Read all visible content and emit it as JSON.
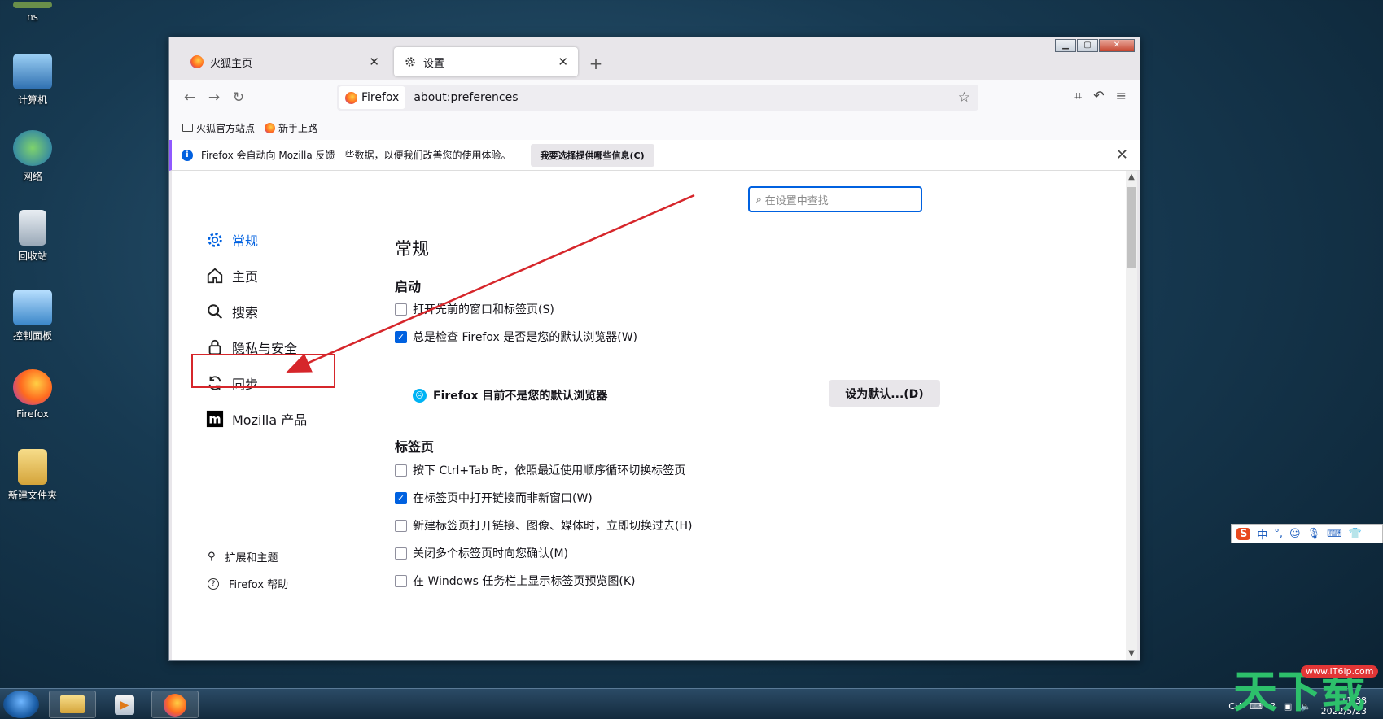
{
  "desktop": {
    "icons": [
      {
        "label": "ns"
      },
      {
        "label": "计算机"
      },
      {
        "label": "网络"
      },
      {
        "label": "回收站"
      },
      {
        "label": "控制面板"
      },
      {
        "label": "Firefox"
      },
      {
        "label": "新建文件夹"
      }
    ]
  },
  "browser": {
    "tabs": [
      {
        "label": "火狐主页"
      },
      {
        "label": "设置"
      }
    ],
    "url_identity": "Firefox",
    "url": "about:preferences",
    "bookmarks": [
      {
        "label": "火狐官方站点"
      },
      {
        "label": "新手上路"
      }
    ],
    "notice": {
      "text": "Firefox 会自动向 Mozilla 反馈一些数据，以便我们改善您的使用体验。",
      "button": "我要选择提供哪些信息(C)"
    }
  },
  "settings": {
    "search_placeholder": "在设置中查找",
    "nav": [
      {
        "label": "常规",
        "selected": true
      },
      {
        "label": "主页"
      },
      {
        "label": "搜索"
      },
      {
        "label": "隐私与安全"
      },
      {
        "label": "同步"
      },
      {
        "label": "Mozilla 产品"
      }
    ],
    "bottom_links": [
      {
        "label": "扩展和主题"
      },
      {
        "label": "Firefox 帮助"
      }
    ],
    "page_title": "常规",
    "startup": {
      "heading": "启动",
      "restore_session": "打开先前的窗口和标签页(S)",
      "check_default": "总是检查 Firefox 是否是您的默认浏览器(W)",
      "default_status": "Firefox 目前不是您的默认浏览器",
      "set_default_button": "设为默认...(D)"
    },
    "tabs_section": {
      "heading": "标签页",
      "options": [
        {
          "label": "按下 Ctrl+Tab 时，依照最近使用顺序循环切换标签页",
          "checked": false
        },
        {
          "label": "在标签页中打开链接而非新窗口(W)",
          "checked": true
        },
        {
          "label": "新建标签页打开链接、图像、媒体时，立即切换过去(H)",
          "checked": false
        },
        {
          "label": "关闭多个标签页时向您确认(M)",
          "checked": false
        },
        {
          "label": "在 Windows 任务栏上显示标签页预览图(K)",
          "checked": false
        }
      ]
    }
  },
  "taskbar": {
    "tray_lang": "CH",
    "clock_time": "11:38",
    "clock_date": "2022/5/23"
  },
  "ime": {
    "mode": "中"
  },
  "watermark": {
    "text": "天下载",
    "badge": "www.IT6ip.com"
  },
  "colors": {
    "accent": "#0061e0",
    "annotation": "#d6262b"
  }
}
